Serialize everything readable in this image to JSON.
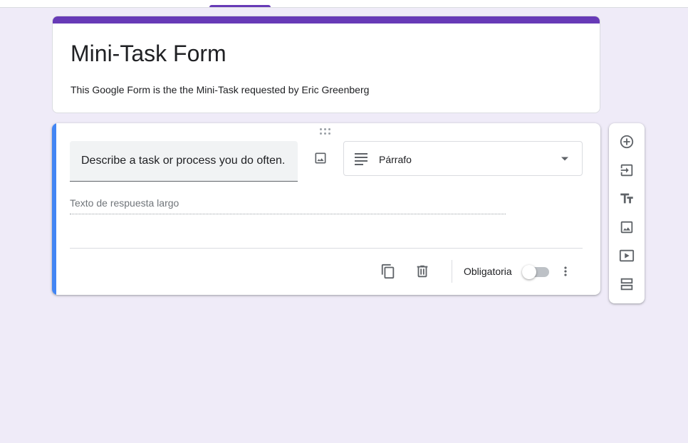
{
  "colors": {
    "background": "#efebf8",
    "theme_accent": "#673ab7",
    "active_question_accent": "#4285f4",
    "icon_gray": "#5f6368"
  },
  "form": {
    "title": "Mini-Task Form",
    "description": "This Google Form is the the Mini-Task requested by  Eric Greenberg"
  },
  "question": {
    "title": "Describe a task or process you do often.",
    "type_label": "Párrafo",
    "type_icon": "paragraph-lines-icon",
    "answer_placeholder": "Texto de respuesta largo",
    "required_label": "Obligatoria",
    "required": false
  },
  "side_toolbar": {
    "tools": [
      "add-question-icon",
      "import-questions-icon",
      "add-title-icon",
      "add-image-icon",
      "add-video-icon",
      "add-section-icon"
    ]
  }
}
